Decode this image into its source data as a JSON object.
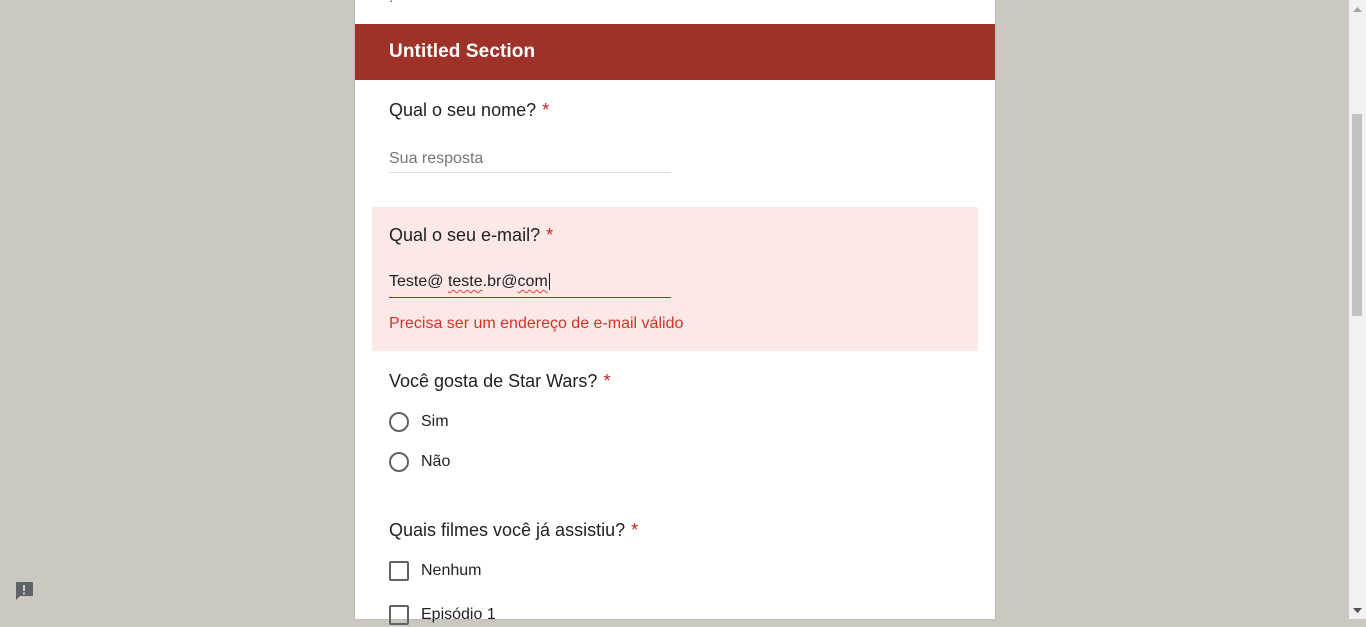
{
  "top_fragment": "·",
  "section": {
    "title": "Untitled Section"
  },
  "questions": {
    "name": {
      "title": "Qual o seu nome?",
      "required_mark": "*",
      "placeholder": "Sua resposta"
    },
    "email": {
      "title": "Qual o seu e-mail?",
      "required_mark": "*",
      "value_part1": "Teste@ ",
      "value_part2": "teste",
      "value_part3": ".br@",
      "value_part4": "com",
      "error": "Precisa ser um endereço de e-mail válido"
    },
    "star_wars": {
      "title": "Você gosta de Star Wars?",
      "required_mark": "*",
      "options": [
        "Sim",
        "Não"
      ]
    },
    "films": {
      "title": "Quais filmes você já assistiu?",
      "required_mark": "*",
      "options": [
        "Nenhum",
        "Episódio 1"
      ]
    }
  },
  "colors": {
    "background": "#cbc8c1",
    "section_header": "#9e3229",
    "error_background": "#fde8e8",
    "error_text": "#d93025"
  }
}
